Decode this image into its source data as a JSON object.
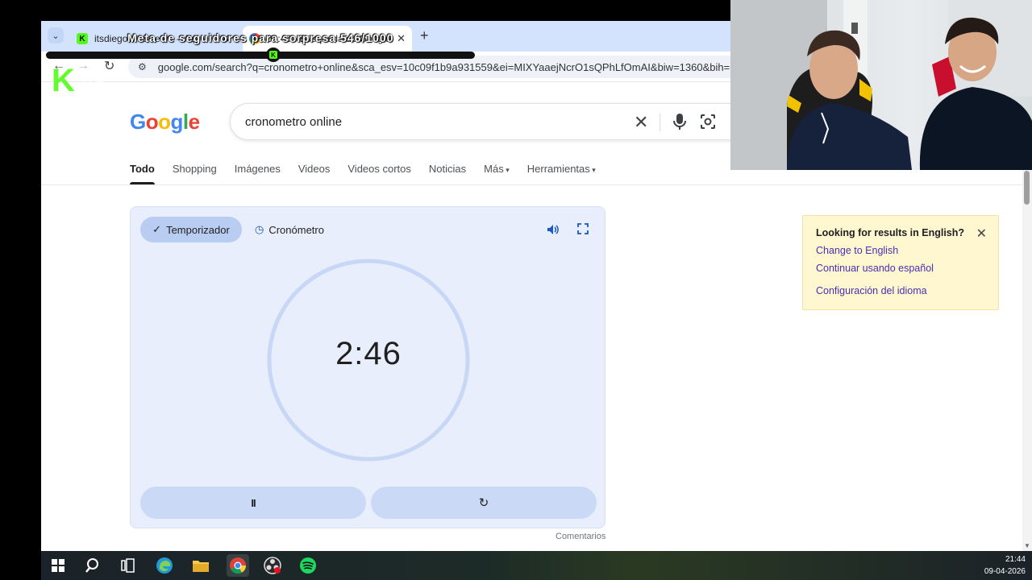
{
  "browser": {
    "tabs": [
      {
        "title": "itsdiegov... Stream - Wa",
        "favicon": "kick-icon",
        "active": false
      },
      {
        "title": "02:46 - Búsqueda de Google",
        "favicon": "google-icon",
        "active": true
      }
    ],
    "new_tab_label": "+",
    "url": "google.com/search?q=cronometro+online&sca_esv=10c09f1b9a931559&ei=MIXYaaejNcrO1sQPhLfOmAI&biw=1360&bih=641&"
  },
  "google": {
    "logo_text": "Google",
    "logo_colors": [
      "#4285F4",
      "#EA4335",
      "#FBBC05",
      "#4285F4",
      "#34A853",
      "#EA4335"
    ],
    "query": "cronometro online",
    "tabs": [
      "Todo",
      "Shopping",
      "Imágenes",
      "Videos",
      "Videos cortos",
      "Noticias",
      "Más",
      "Herramientas"
    ],
    "active_tab": "Todo"
  },
  "timer": {
    "mode_timer_label": "Temporizador",
    "mode_stopwatch_label": "Cronómetro",
    "time": "2:46",
    "remaining_fraction": 0.4,
    "accent": "#1a56c4",
    "track_color": "#c7d7f5",
    "pause_symbol": "II",
    "reset_symbol": "↻",
    "feedback_label": "Comentarios"
  },
  "language_notice": {
    "title": "Looking for results in English?",
    "link_change": "Change to English",
    "link_continue": "Continuar usando español",
    "link_settings": "Configuración del idioma"
  },
  "overlay": {
    "text": "Meta de seguidores para sorpresa 546/1000",
    "progress_fraction": 0.53,
    "brand_color": "#53fc18",
    "logo_letter": "K",
    "logo_number": "48"
  },
  "taskbar": {
    "time": "21:44",
    "date": "09-04-2026",
    "icons": [
      "windows-start-icon",
      "search-icon",
      "task-view-icon",
      "edge-icon",
      "file-explorer-icon",
      "chrome-icon",
      "obs-icon",
      "spotify-icon"
    ]
  }
}
